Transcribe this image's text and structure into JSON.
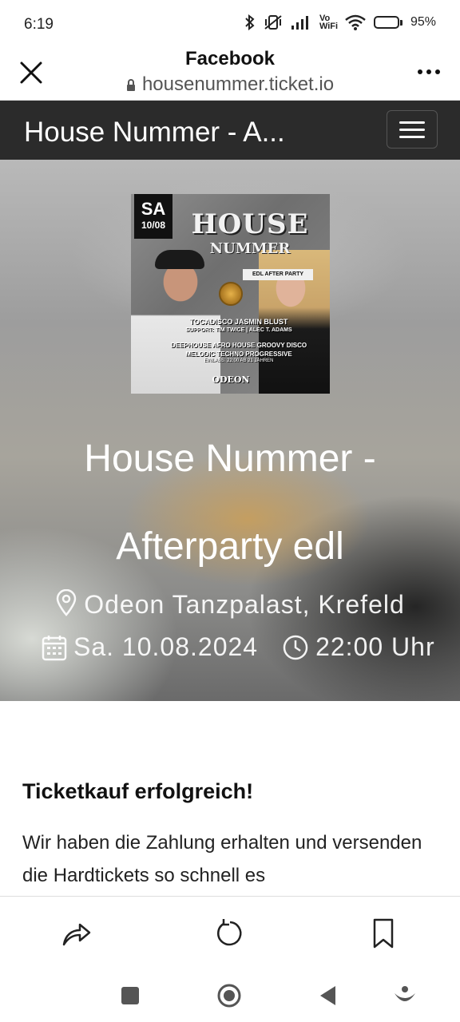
{
  "status_bar": {
    "time": "6:19",
    "vowifi": "Vo WiFi",
    "battery_percent": "95%",
    "battery_level": 0.95,
    "icons": [
      "bluetooth-icon",
      "vibrate-icon",
      "signal-icon",
      "wifi-icon",
      "battery-icon"
    ]
  },
  "browser": {
    "app_title": "Facebook",
    "url": "housenummer.ticket.io",
    "close_icon": "close-icon",
    "more_icon": "more-icon"
  },
  "site": {
    "nav_title": "House Nummer - A...",
    "menu_icon": "hamburger-icon"
  },
  "poster": {
    "day": "SA",
    "date": "10/08",
    "title_line1": "HOUSE",
    "title_line2": "NUMMER",
    "banner": "EDL AFTER PARTY",
    "names": "TOCADISCO   JASMIN BLUST",
    "support": "SUPPORT: TIM TWICE | ALEC T. ADAMS",
    "genres_line1": "DEEPHOUSE  AFRO HOUSE  GROOVY DISCO",
    "genres_line2": "MELODIC TECHNO  PROGRESSIVE",
    "entry": "EINLASS: 22:00  AB 21 JAHREN",
    "venue": "ODEON"
  },
  "event": {
    "title": "House Nummer - Afterparty edl",
    "venue": "Odeon Tanzpalast, Krefeld",
    "date": "Sa. 10.08.2024",
    "time": "22:00 Uhr"
  },
  "content": {
    "heading": "Ticketkauf erfolgreich!",
    "body": "Wir haben die Zahlung erhalten und versenden die Hardtickets so schnell es"
  },
  "toolbar": {
    "icons": [
      "share-icon",
      "reload-icon",
      "bookmark-icon"
    ]
  },
  "system_nav": {
    "icons": [
      "recents-icon",
      "home-icon",
      "back-icon",
      "assist-icon"
    ]
  },
  "colors": {
    "navbar_bg": "#2b2b2b",
    "hero_text": "#ffffff",
    "page_bg": "#ffffff"
  }
}
